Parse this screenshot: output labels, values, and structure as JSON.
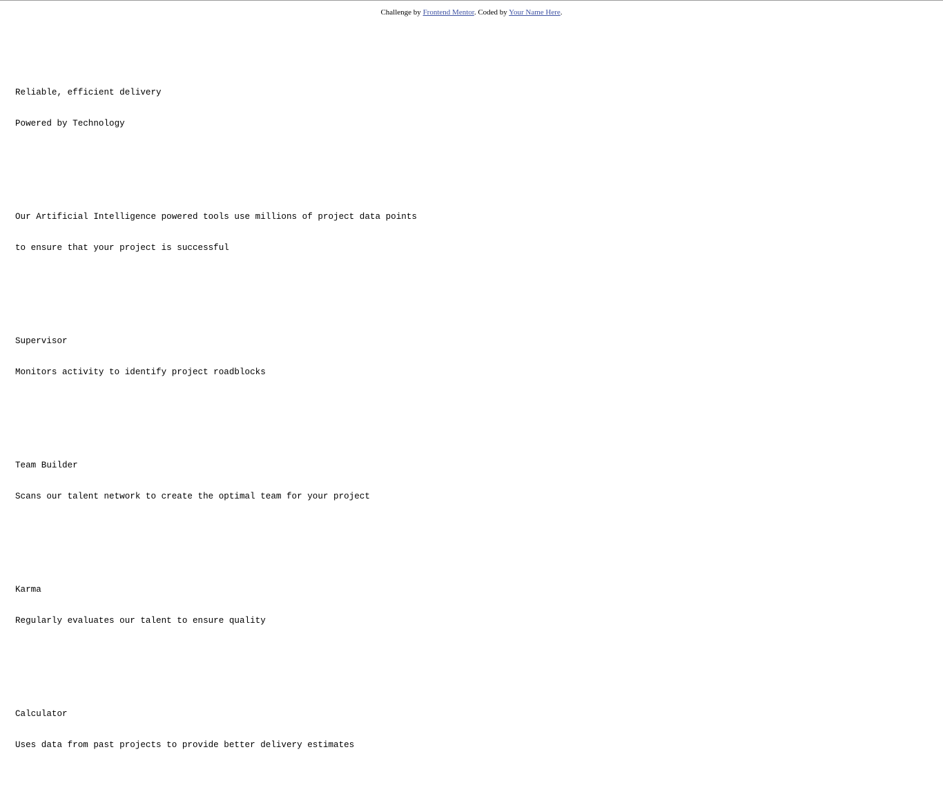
{
  "attribution": {
    "prefix": "Challenge by ",
    "challenge_link": "Frontend Mentor",
    "middle": ". Coded by ",
    "author_link": "Your Name Here",
    "suffix": "."
  },
  "hero": {
    "subtitle": "Reliable, efficient delivery",
    "title": "Powered by Technology"
  },
  "intro": {
    "line1": "Our Artificial Intelligence powered tools use millions of project data points",
    "line2": "to ensure that your project is successful"
  },
  "features": [
    {
      "title": "Supervisor",
      "description": "Monitors activity to identify project roadblocks"
    },
    {
      "title": "Team Builder",
      "description": "Scans our talent network to create the optimal team for your project"
    },
    {
      "title": "Karma",
      "description": "Regularly evaluates our talent to ensure quality"
    },
    {
      "title": "Calculator",
      "description": "Uses data from past projects to provide better delivery estimates"
    }
  ],
  "colors": {
    "link": "#3e52a3",
    "text": "#000000",
    "background": "#ffffff"
  }
}
